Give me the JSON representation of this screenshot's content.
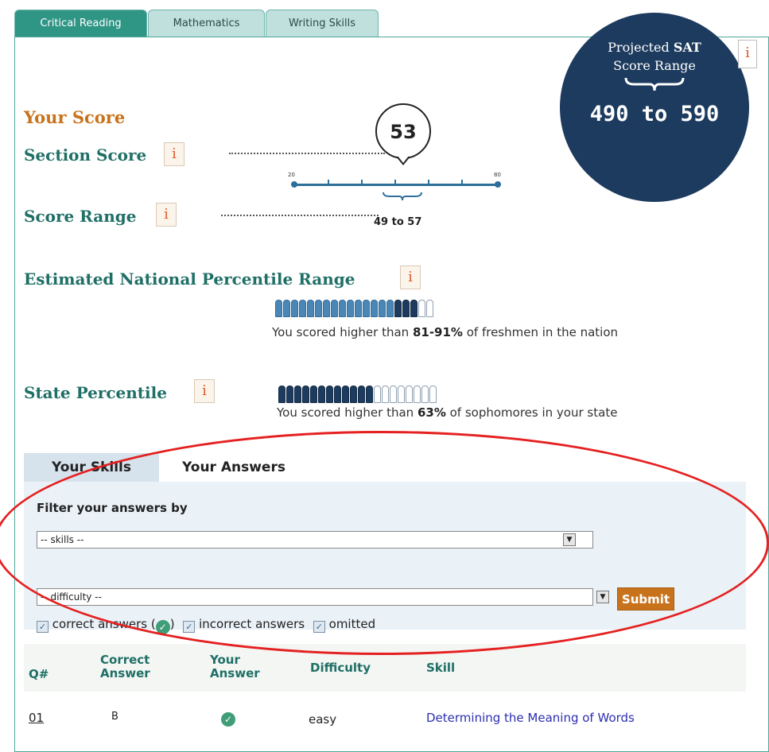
{
  "tabs": [
    "Critical Reading",
    "Mathematics",
    "Writing Skills"
  ],
  "score": {
    "title": "Your Score",
    "section_label": "Section Score",
    "range_label": "Score Range",
    "value": "53",
    "scale_min": "20",
    "scale_max": "80",
    "range_text": "49 to 57",
    "info_glyph": "i"
  },
  "sat": {
    "line1_pre": "Projected ",
    "line1_bold": "SAT",
    "line2": "Score Range",
    "range": "490 to 590"
  },
  "national": {
    "label": "Estimated National Percentile Range",
    "text_pre": "You scored higher than ",
    "text_bold": "81-91%",
    "text_post": " of freshmen in the nation",
    "lower_pct": 81,
    "upper_pct": 91
  },
  "state": {
    "label": "State Percentile",
    "text_pre": "You scored higher than ",
    "text_bold": "63%",
    "text_post": " of sophomores in your state",
    "pct": 63
  },
  "lower_tabs": [
    "Your Skills",
    "Your Answers"
  ],
  "filter": {
    "title": "Filter your answers by",
    "skills_select": "-- skills --",
    "difficulty_select": "-- difficulty --",
    "submit": "Submit",
    "correct_pre": "correct answers (",
    "correct_post": ")",
    "incorrect": "incorrect answers",
    "omitted": "omitted"
  },
  "table": {
    "headers": [
      "Q#",
      "Correct\nAnswer",
      "Your\nAnswer",
      "Difficulty",
      "Skill"
    ],
    "rows": [
      {
        "q": "01",
        "correct": "B",
        "difficulty": "easy",
        "skill": "Determining the Meaning of Words"
      }
    ]
  },
  "colors": {
    "teal": "#1f6f66",
    "orange": "#c8731c",
    "navy": "#1d3b5e",
    "highlight": "#e52020"
  }
}
